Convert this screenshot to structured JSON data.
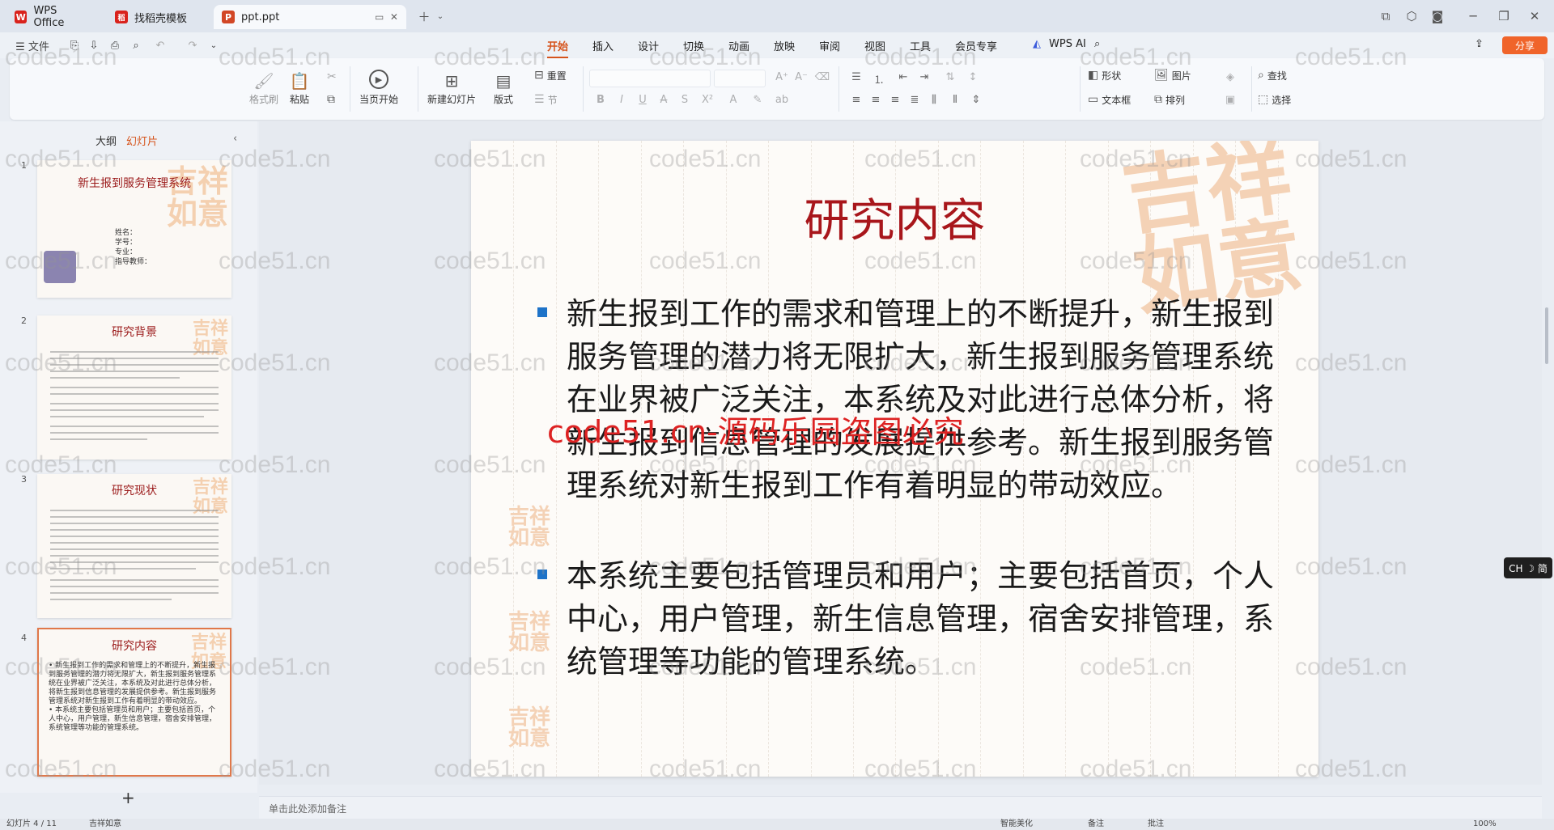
{
  "tabs": [
    {
      "label": "WPS Office",
      "icon_color": "#d9221c",
      "icon_letter": "W"
    },
    {
      "label": "找稻壳模板",
      "icon_color": "#d9221c",
      "icon_letter": "稻"
    },
    {
      "label": "ppt.ppt",
      "icon_color": "#d24726",
      "icon_letter": "P"
    }
  ],
  "menu": {
    "file": "☰ 文件",
    "tabs": [
      "开始",
      "插入",
      "设计",
      "切换",
      "动画",
      "放映",
      "审阅",
      "视图",
      "工具",
      "会员专享"
    ],
    "wps_ai": "WPS AI",
    "share": "分享"
  },
  "ribbon": {
    "format_painter": "格式刷",
    "paste": "粘贴",
    "start_show": "当页开始",
    "new_slide": "新建幻灯片",
    "layout": "版式",
    "reset": "重置",
    "section": "节",
    "shape": "形状",
    "picture": "图片",
    "textbox": "文本框",
    "arrange": "排列",
    "find": "查找",
    "select": "选择"
  },
  "panel": {
    "outline": "大纲",
    "slides": "幻灯片",
    "add": "+"
  },
  "thumbnails": [
    {
      "num": "1",
      "title": "新生报到服务管理系统",
      "fields": [
        "姓名：",
        "学号：",
        "专业：",
        "指导教师："
      ]
    },
    {
      "num": "2",
      "title": "研究背景"
    },
    {
      "num": "3",
      "title": "研究现状"
    },
    {
      "num": "4",
      "title": "研究内容",
      "text": "• 新生报到工作的需求和管理上的不断提升，新生报到服务管理的潜力将无限扩大，新生报到服务管理系统在业界被广泛关注，本系统及对此进行总体分析，将新生报到信息管理的发展提供参考。新生报到服务管理系统对新生报到工作有着明显的带动效应。\n• 本系统主要包括管理员和用户；主要包括首页，个人中心，用户管理，新生信息管理，宿舍安排管理，系统管理等功能的管理系统。"
    }
  ],
  "slide": {
    "title": "研究内容",
    "bullets": [
      "新生报到工作的需求和管理上的不断提升，新生报到服务管理的潜力将无限扩大，新生报到服务管理系统在业界被广泛关注，本系统及对此进行总体分析，将新生报到信息管理的发展提供参考。新生报到服务管理系统对新生报到工作有着明显的带动效应。",
      "本系统主要包括管理员和用户；主要包括首页，个人中心，用户管理，新生信息管理，宿舍安排管理，系统管理等功能的管理系统。"
    ],
    "title_color": "#a8161b",
    "bullet_color": "#1e73c8"
  },
  "notes_placeholder": "单击此处添加备注",
  "watermark": {
    "text": "code51.cn",
    "red_text": "code51.cn-源码乐园盗图必究"
  },
  "ime": "CH ☽ 简",
  "status": {
    "slide_info": "幻灯片 4 / 11",
    "theme": "吉祥如意",
    "smart": "智能美化",
    "notes": "备注",
    "comment": "批注",
    "zoom": "100%"
  }
}
